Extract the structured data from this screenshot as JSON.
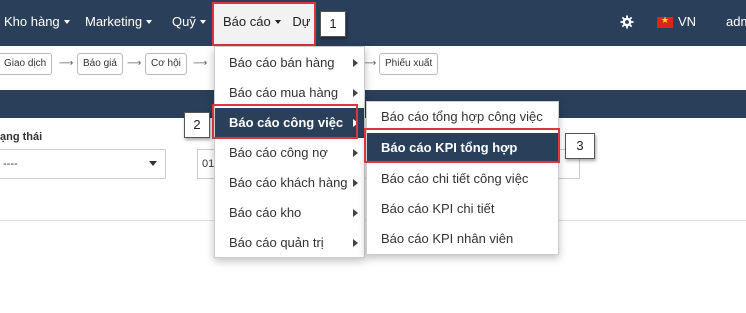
{
  "navbar": {
    "items": [
      {
        "label": "Kho hàng"
      },
      {
        "label": "Marketing"
      },
      {
        "label": "Quỹ"
      }
    ],
    "active_item": "Báo cáo",
    "next_item": "Dự",
    "language": "VN",
    "user": "adm",
    "colors": {
      "bar": "#2a3f5a",
      "highlight": "#d9363e"
    }
  },
  "callouts": [
    "1",
    "2",
    "3"
  ],
  "breadcrumb": {
    "steps": [
      "Giao dịch",
      "Báo giá",
      "Cơ hội"
    ],
    "last_step": "Phiếu xuất"
  },
  "filter": {
    "label": "ạng thái",
    "status_value": "----",
    "second_value": "01"
  },
  "report_menu": {
    "items": [
      "Báo cáo bán hàng",
      "Báo cáo mua hàng",
      "Báo cáo công việc",
      "Báo cáo công nợ",
      "Báo cáo khách hàng",
      "Báo cáo kho",
      "Báo cáo quản trị"
    ],
    "active_index": 2
  },
  "work_report_submenu": {
    "items": [
      "Báo cáo tổng hợp công việc",
      "Báo cáo KPI tổng hợp",
      "Báo cáo chi tiết công việc",
      "Báo cáo KPI chi tiết",
      "Báo cáo KPI nhân viên"
    ],
    "active_index": 1
  }
}
